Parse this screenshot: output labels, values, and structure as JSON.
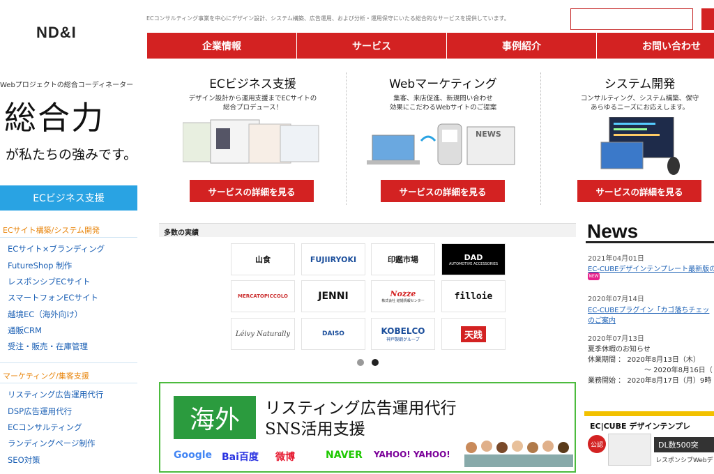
{
  "header": {
    "logo": "ND&I",
    "tagline": "ECコンサルティング事業を中心にデザイン設計、システム構築、広告運用、および分析・運用保守にいたる総合的なサービスを提供しています。"
  },
  "nav": [
    "企業情報",
    "サービス",
    "事例紹介",
    "お問い合わせ"
  ],
  "hero": {
    "intro": "Webプロジェクトの総合コーディネーター",
    "big": "総合力",
    "sub": "が私たちの強みです。"
  },
  "sidebar": {
    "head": "ECビジネス支援",
    "sec1": "ECサイト構築/システム開発",
    "items1": [
      "ECサイト×ブランディング",
      "FutureShop 制作",
      "レスポンシブECサイト",
      "スマートフォンECサイト",
      "越境EC（海外向け）",
      "通販CRM",
      "受注・販売・在庫管理"
    ],
    "sec2": "マーケティング/集客支援",
    "items2": [
      "リスティング広告運用代行",
      "DSP広告運用代行",
      "ECコンサルティング",
      "ランディングページ制作",
      "SEO対策"
    ]
  },
  "services": [
    {
      "title": "ECビジネス支援",
      "desc1": "デザイン設計から運用支援までECサイトの",
      "desc2": "総合プロデュース！",
      "btn": "サービスの詳細を見る"
    },
    {
      "title": "Webマーケティング",
      "desc1": "集客、来店促進、新規問い合わせ",
      "desc2": "効果にこだわるWebサイトのご提案",
      "btn": "サービスの詳細を見る",
      "news_label": "NEWS"
    },
    {
      "title": "システム開発",
      "desc1": "コンサルティング、システム構築、保守",
      "desc2": "あらゆるニーズにお応えします。",
      "btn": "サービスの詳細を見る"
    }
  ],
  "achievements": {
    "label": "多数の実績",
    "logos": [
      "山食",
      "FUJIIRYOKI",
      "印鑑市場",
      "DAD",
      "MERCATOPICCOLO",
      "JENNI",
      "Nozze",
      "filloie",
      "Léivy Naturally",
      "DAISO",
      "KOBELCO",
      "天践"
    ],
    "logo_subs": [
      "",
      "",
      "",
      "AUTOMOTIVE ACCESSORIES",
      "",
      "",
      "株式会社 結婚情報センター",
      "",
      "",
      "",
      "神戸製鋼グループ",
      ""
    ]
  },
  "ad": {
    "kanji": "海外",
    "line1": "リスティング広告運用代行",
    "line2": "SNS活用支援",
    "brands": [
      "Google",
      "Bai百度",
      "微博",
      "NAVER",
      "YAHOO!",
      "YAHOO!"
    ],
    "brand_colors": [
      "#4285f4",
      "#2932e1",
      "#e6162d",
      "#1ec800",
      "#7b0099",
      "#7b0099"
    ]
  },
  "news": {
    "title": "News",
    "new_badge": "NEW",
    "items": [
      {
        "date": "2021年04月01日",
        "lines": [
          "EC-CUBEデザインテンプレート最新版の"
        ]
      },
      {
        "date": "2020年07月14日",
        "lines": [
          "EC-CUBEプラグイン「カゴ落ちチェッ",
          "のご案内"
        ]
      },
      {
        "date": "2020年07月13日",
        "text": [
          "夏季休暇のお知らせ",
          "休業期間 ： 2020年8月13日（木）",
          "～ 2020年8月16日（",
          "業務開始 ： 2020年8月17日（月）9時"
        ]
      }
    ]
  },
  "banner": {
    "title": "EC|CUBE デザインテンプレ",
    "badge": "公認",
    "dl": "DL数500突",
    "resp": "レスポンシブWebデ"
  },
  "colors": {
    "accent": "#d32222",
    "sidebar_blue": "#29a3e3",
    "link": "#1a5fb4",
    "orange": "#e8850c",
    "ad_green": "#2b9b3e"
  }
}
